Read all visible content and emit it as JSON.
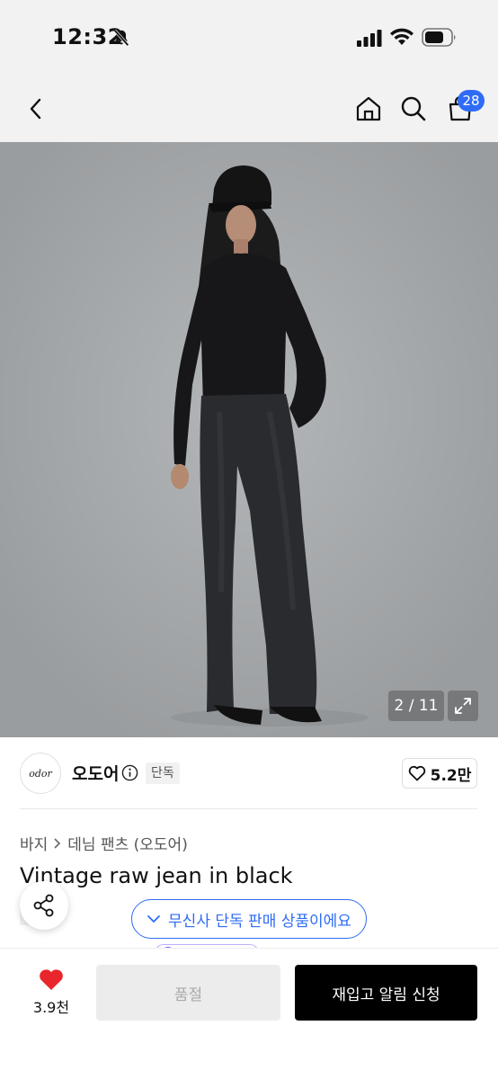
{
  "status_bar": {
    "time": "12:32",
    "icons": [
      "bell-slash-icon",
      "signal-icon",
      "wifi-icon",
      "battery-icon"
    ]
  },
  "nav": {
    "icons": [
      "chevron-left-icon",
      "home-icon",
      "search-icon",
      "cart-icon"
    ],
    "cart_count": "28"
  },
  "gallery": {
    "counter": "2 / 11",
    "expand_icon": "expand-icon"
  },
  "brand": {
    "logo_text": "odor",
    "name": "오도어",
    "tag": "단독",
    "likes": "5.2만"
  },
  "breadcrumb": [
    "바지",
    "데님 팬츠 (오도어)"
  ],
  "product": {
    "title": "Vintage raw jean in black",
    "exclusive_tag": "단독",
    "exclusive_notice": "무신사 단독 판매 상품이에요"
  },
  "bottom_bar": {
    "wish_count": "3.9천",
    "soldout_label": "품절",
    "restock_label": "재입고 알림 신청"
  },
  "colors": {
    "accent_blue": "#2f6cf6",
    "heart_red": "#e8262b",
    "cta_black": "#000000"
  }
}
